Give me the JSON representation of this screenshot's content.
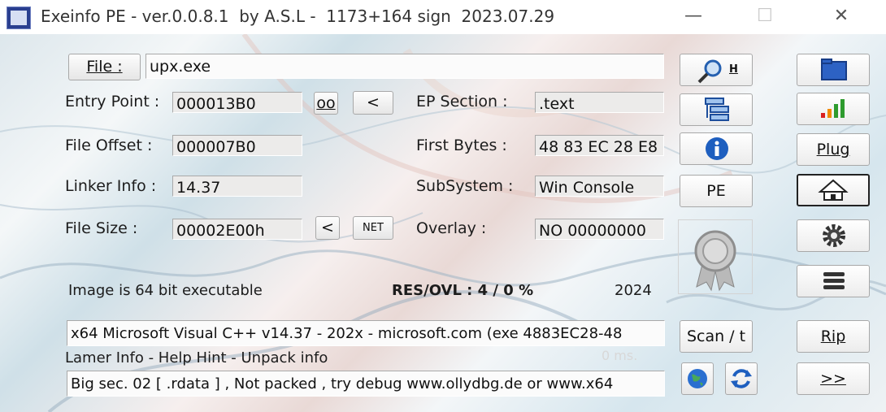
{
  "window": {
    "title": "Exeinfo PE - ver.0.0.8.1  by A.S.L -  1173+164 sign  2023.07.29",
    "minimize": "—",
    "maximize": "☐",
    "close": "✕"
  },
  "file": {
    "button_label": "File :",
    "value": "upx.exe"
  },
  "fields": {
    "entry_point": {
      "label": "Entry Point :",
      "value": "000013B0"
    },
    "file_offset": {
      "label": "File Offset :",
      "value": "000007B0"
    },
    "linker_info": {
      "label": "Linker Info :",
      "value": "14.37"
    },
    "file_size": {
      "label": "File Size :",
      "value": "00002E00h"
    },
    "ep_section": {
      "label": "EP Section :",
      "value": ".text"
    },
    "first_bytes": {
      "label": "First Bytes :",
      "value": "48 83 EC 28 E8"
    },
    "subsystem": {
      "label": "SubSystem :",
      "value": "Win Console"
    },
    "overlay": {
      "label": "Overlay :",
      "value": "NO   00000000"
    }
  },
  "small_buttons": {
    "oo": "oo",
    "lt1": "<",
    "lt2": "<",
    "net": "NET"
  },
  "middle": {
    "search_h": "H",
    "pe": "PE",
    "scan": "Scan / t"
  },
  "right": {
    "plug": "Plug",
    "rip": "Rip",
    "next": ">>"
  },
  "info": {
    "image_bits": "Image is 64 bit executable",
    "res_ovl": "RES/OVL : 4 / 0 %",
    "year": "2024",
    "detection": " x64 Microsoft Visual C++ v14.37 - 202x - microsoft.com (exe 4883EC28-48",
    "lamer_info": "Lamer Info - Help Hint - Unpack info",
    "time_ms": "0 ms.",
    "hint": "Big sec. 02 [ .rdata ] , Not packed , try debug www.ollydbg.de or www.x64"
  },
  "colors": {
    "accent": "#1e5fbf",
    "status_red": "#d92020",
    "status_green": "#2e9b2e",
    "status_orange": "#f08a00"
  }
}
